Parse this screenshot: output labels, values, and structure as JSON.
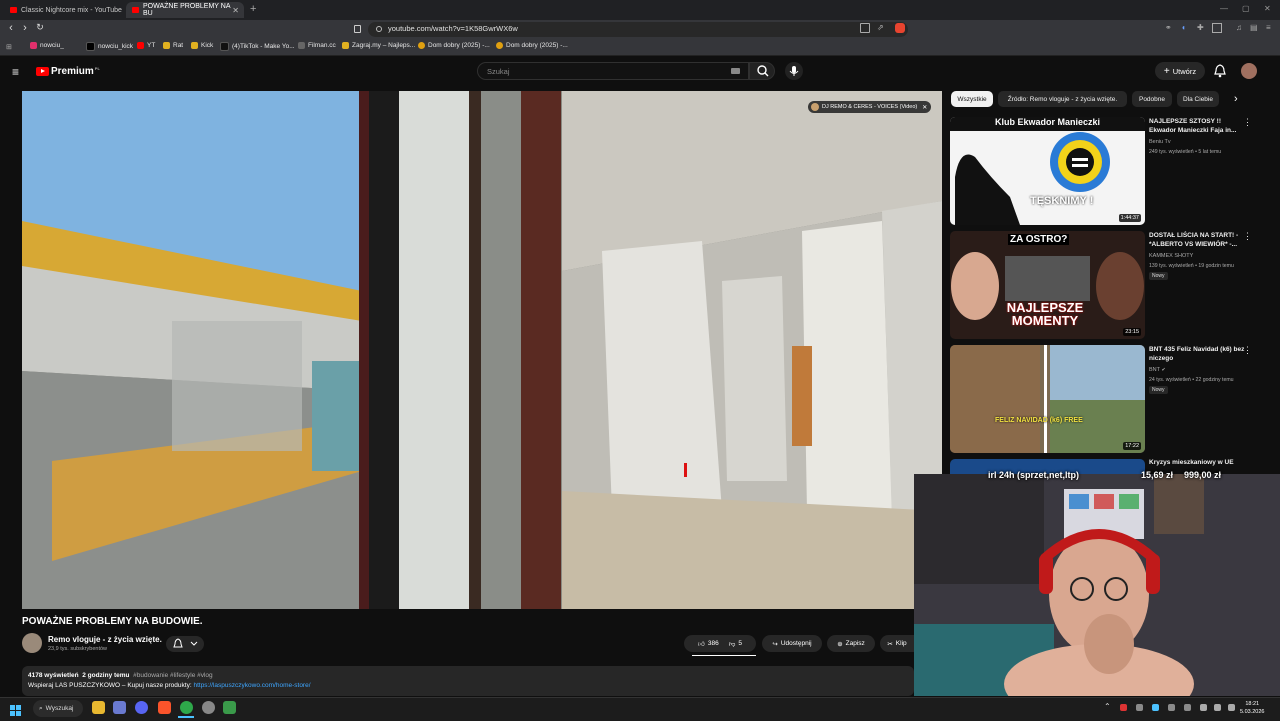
{
  "browser": {
    "tabs": [
      {
        "title": "Classic Nightcore mix - YouTube",
        "active": false
      },
      {
        "title": "POWAŻNE PROBLEMY NA BU",
        "active": true
      }
    ],
    "url": "youtube.com/watch?v=1K58GwrWX6w",
    "bookmarks": [
      "nowciu_",
      "nowciu_kick",
      "YT",
      "Rat",
      "Kick",
      "(4)TikTok - Make Yo...",
      "Filman.cc",
      "Zagraj.my – Najleps...",
      "Dom dobry (2025) -...",
      "Dom dobry (2025) -..."
    ]
  },
  "youtube": {
    "logo": "Premium",
    "logo_region": "PL",
    "search_placeholder": "Szukaj",
    "create_label": "Utwórz"
  },
  "video": {
    "title": "POWAŻNE PROBLEMY NA BUDOWIE.",
    "channel": "Remo vloguje - z życia wzięte.",
    "subscribers": "23,9 tys. subskrybentów",
    "likes": "386",
    "dislikes": "5",
    "share_label": "Udostępnij",
    "save_label": "Zapisz",
    "clip_label": "Klip",
    "mini_title": "DJ REMO & CERES - VOICES (Video)",
    "views": "4178 wyświetleń",
    "age": "2 godziny temu",
    "tags": "#budowanie #lifestyle #vlog",
    "desc_text": "Wspieraj LAS PUSZCZYKOWO – Kupuj nasze produkty:",
    "desc_link": "https://laspuszczykowo.com/home-store/"
  },
  "chips": [
    "Wszystkie",
    "Źródło: Remo vloguje - z życia wzięte.",
    "Podobne",
    "Dla Ciebie"
  ],
  "recommendations": [
    {
      "title": "NAJLEPSZE SZTOSY !! Ekwador Manieczki Faja in...",
      "channel": "Beniu Tv",
      "meta": "249 tys. wyświetleń • 5 lat temu",
      "duration": "1:44:37",
      "badge": "",
      "thumb_text": "TĘSKNIMY !",
      "thumb_header": "Klub Ekwador Manieczki"
    },
    {
      "title": "DOSTAŁ LIŚCIA NA START! - *ALBERTO VS WIEWIÓR* -...",
      "channel": "KAMMEX SHOTY",
      "meta": "139 tys. wyświetleń • 19 godzin temu",
      "duration": "23:15",
      "badge": "Nowy",
      "thumb_text": "NAJLEPSZE MOMENTY",
      "thumb_header": "ZA OSTRO?"
    },
    {
      "title": "BNT 435 Feliz Navidad (k6) bez niczego",
      "channel": "BNT",
      "meta": "24 tys. wyświetleń • 22 godziny temu",
      "duration": "17:22",
      "badge": "Nowy",
      "thumb_text": "FELIZ NAVIDAD (k6) FREE",
      "thumb_header": ""
    },
    {
      "title": "Kryzys mieszkaniowy w UE",
      "channel": "",
      "meta": "",
      "duration": "",
      "badge": "",
      "thumb_text": "",
      "thumb_header": ""
    }
  ],
  "overlay": {
    "ticker_left": "irl 24h (sprzet,net,ltp)",
    "ticker_mid": "15,69 zł",
    "ticker_right": "999,00 zł"
  },
  "taskbar": {
    "search_label": "Wyszukaj",
    "time": "18:21",
    "date": "5.03.2026"
  }
}
